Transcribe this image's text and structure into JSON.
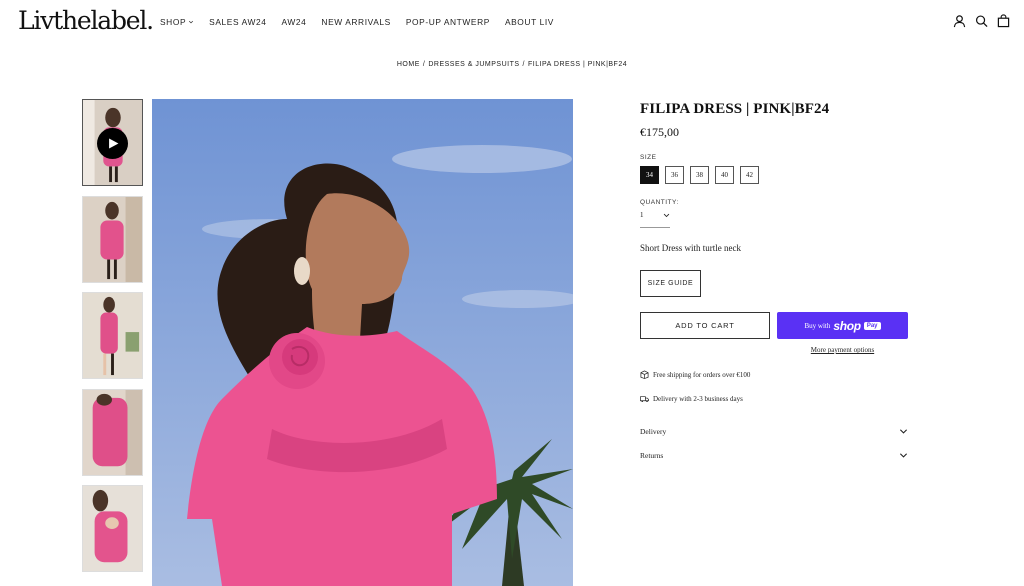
{
  "brand": {
    "logo_text": "Livthelabel."
  },
  "nav": {
    "items": [
      {
        "label": "SHOP",
        "has_dropdown": true
      },
      {
        "label": "SALES AW24"
      },
      {
        "label": "AW24"
      },
      {
        "label": "NEW ARRIVALS"
      },
      {
        "label": "POP-UP ANTWERP"
      },
      {
        "label": "ABOUT LIV"
      }
    ]
  },
  "header_icons": [
    "account-icon",
    "search-icon",
    "cart-icon"
  ],
  "breadcrumb": [
    "HOME",
    "DRESSES & JUMPSUITS",
    "FILIPA DRESS | PINK|BF24"
  ],
  "product": {
    "title": "FILIPA DRESS | PINK|BF24",
    "price": "€175,00",
    "size_label": "SIZE",
    "sizes": [
      "34",
      "36",
      "38",
      "40",
      "42"
    ],
    "selected_size": "34",
    "quantity_label": "QUANTITY:",
    "quantity_value": "1",
    "description": "Short Dress with turtle neck",
    "size_guide_label": "SIZE GUIDE",
    "add_to_cart_label": "ADD TO CART",
    "shop_pay": {
      "buy_text": "Buy with",
      "brand": "shop",
      "pay": "Pay"
    },
    "more_payment_label": "More payment options",
    "shipping_info": "Free shipping for orders over €100",
    "delivery_info": "Delivery with 2-3 business days",
    "accordions": [
      "Delivery",
      "Returns"
    ]
  },
  "colors": {
    "accent_pink": "#e8508f",
    "shop_pay_purple": "#5a31f4",
    "sky_blue": "#7f9fd6"
  }
}
